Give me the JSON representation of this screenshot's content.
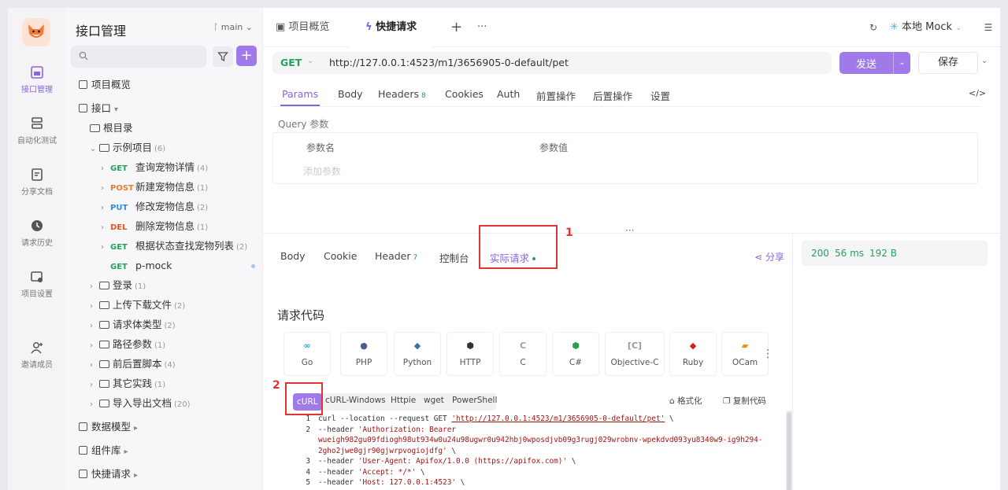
{
  "rail": {
    "items": [
      {
        "label": "接口管理",
        "icon": "api-icon",
        "active": true
      },
      {
        "label": "自动化测试",
        "icon": "automation-icon"
      },
      {
        "label": "分享文档",
        "icon": "share-doc-icon"
      },
      {
        "label": "请求历史",
        "icon": "history-icon"
      },
      {
        "label": "项目设置",
        "icon": "settings-icon"
      },
      {
        "label": "邀请成员",
        "icon": "invite-icon"
      }
    ]
  },
  "sidebar": {
    "title": "接口管理",
    "branch": "main",
    "tree": [
      {
        "label": "项目概览",
        "kind": "overview"
      },
      {
        "label": "接口",
        "kind": "section"
      },
      {
        "label": "根目录",
        "kind": "folder"
      },
      {
        "label": "示例项目",
        "count": "(6)",
        "kind": "folder-open"
      },
      {
        "method": "GET",
        "label": "查询宠物详情",
        "count": "(4)"
      },
      {
        "method": "POST",
        "label": "新建宠物信息",
        "count": "(1)"
      },
      {
        "method": "PUT",
        "label": "修改宠物信息",
        "count": "(2)"
      },
      {
        "method": "DEL",
        "label": "删除宠物信息",
        "count": "(1)"
      },
      {
        "method": "GET",
        "label": "根据状态查找宠物列表",
        "count": "(2)"
      },
      {
        "method": "GET",
        "label": "p-mock",
        "count": ""
      },
      {
        "label": "登录",
        "count": "(1)",
        "kind": "folder"
      },
      {
        "label": "上传下载文件",
        "count": "(2)",
        "kind": "folder"
      },
      {
        "label": "请求体类型",
        "count": "(2)",
        "kind": "folder"
      },
      {
        "label": "路径参数",
        "count": "(1)",
        "kind": "folder"
      },
      {
        "label": "前后置脚本",
        "count": "(4)",
        "kind": "folder"
      },
      {
        "label": "其它实践",
        "count": "(1)",
        "kind": "folder"
      },
      {
        "label": "导入导出文档",
        "count": "(20)",
        "kind": "folder"
      },
      {
        "label": "数据模型",
        "kind": "section"
      },
      {
        "label": "组件库",
        "kind": "section"
      },
      {
        "label": "快捷请求",
        "kind": "section"
      }
    ]
  },
  "topbar": {
    "tab_overview": "项目概览",
    "tab_quick": "快捷请求",
    "env": "本地 Mock"
  },
  "request": {
    "method": "GET",
    "url": "http://127.0.0.1:4523/m1/3656905-0-default/pet",
    "send": "发送",
    "save": "保存",
    "tabs": [
      "Params",
      "Body",
      "Headers",
      "Cookies",
      "Auth",
      "前置操作",
      "后置操作",
      "设置"
    ],
    "headers_count": "8",
    "query_label": "Query 参数",
    "col_name": "参数名",
    "col_value": "参数值",
    "add_param": "添加参数"
  },
  "response": {
    "tabs": [
      "Body",
      "Cookie",
      "Header",
      "控制台",
      "实际请求"
    ],
    "header_count": "7",
    "share": "分享",
    "status": "200",
    "time": "56 ms",
    "size": "192 B"
  },
  "annotations": {
    "one": "1",
    "two": "2"
  },
  "code": {
    "title": "请求代码",
    "languages": [
      {
        "name": "Go",
        "mark": "∞",
        "color": "#2aa0d8"
      },
      {
        "name": "PHP",
        "mark": "●",
        "color": "#4f5b93"
      },
      {
        "name": "Python",
        "mark": "◆",
        "color": "#3873a8"
      },
      {
        "name": "HTTP",
        "mark": "⬢",
        "color": "#333333"
      },
      {
        "name": "C",
        "mark": "C",
        "color": "#9aa0a6"
      },
      {
        "name": "C#",
        "mark": "⬢",
        "color": "#2e9e4e"
      },
      {
        "name": "Objective-C",
        "mark": "[C]",
        "color": "#999999"
      },
      {
        "name": "Ruby",
        "mark": "◆",
        "color": "#cc2222"
      },
      {
        "name": "OCam",
        "mark": "▰",
        "color": "#f29111"
      }
    ],
    "variants": [
      "cURL",
      "cURL-Windows",
      "Httpie",
      "wget",
      "PowerShell"
    ],
    "format": "格式化",
    "copy": "复制代码",
    "lines": [
      {
        "n": "1",
        "pre": "curl --location --request GET ",
        "str": "'http://127.0.0.1:4523/m1/3656905-0-default/pet'",
        "post": " \\"
      },
      {
        "n": "2",
        "pre": "--header ",
        "str": "'Authorization: Bearer",
        "post": ""
      },
      {
        "n": "",
        "pre": "",
        "str": "wueigh982gu09fdiogh98ut934w0u24u98ugwr0u942hbj0wposdjvb09g3rugj029wrobnv-wpekdvd093yu8340w9-ig9h294-",
        "post": ""
      },
      {
        "n": "",
        "pre": "",
        "str": "2gho2jwe0gjr90gjwrpvogiojdfg'",
        "post": " \\"
      },
      {
        "n": "3",
        "pre": "--header ",
        "str": "'User-Agent: Apifox/1.0.0 (https://apifox.com)'",
        "post": " \\"
      },
      {
        "n": "4",
        "pre": "--header ",
        "str": "'Accept: */*'",
        "post": " \\"
      },
      {
        "n": "5",
        "pre": "--header ",
        "str": "'Host: 127.0.0.1:4523'",
        "post": " \\"
      }
    ]
  },
  "colors": {
    "accent": "#9f7ae8",
    "get": "#21a35b",
    "post": "#ed7a2c",
    "put": "#2f8be6",
    "del": "#e8531f",
    "annotation": "#e03434"
  }
}
